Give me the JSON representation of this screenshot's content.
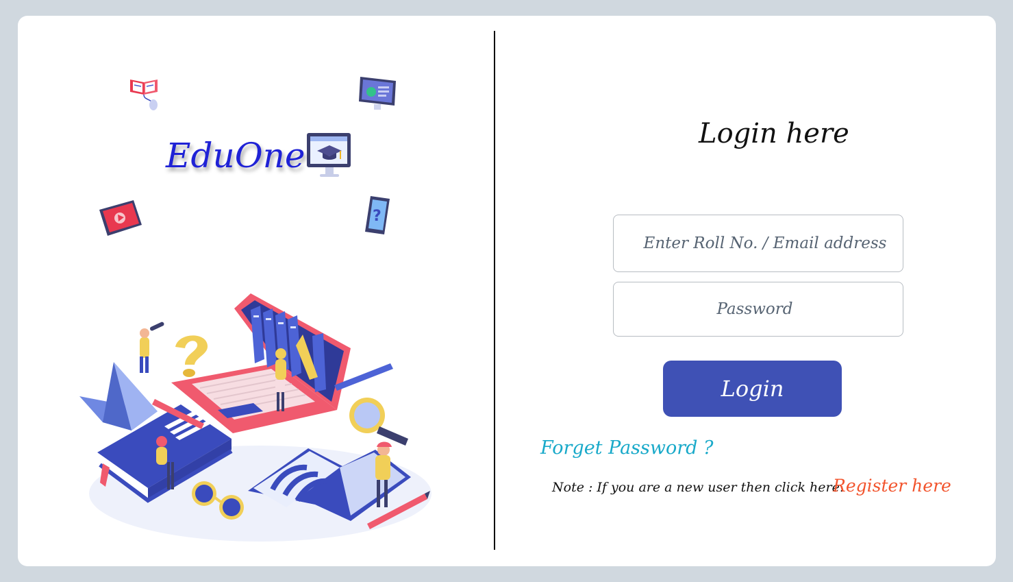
{
  "brand": {
    "name": "EduOne"
  },
  "login": {
    "title": "Login here",
    "roll_placeholder": "Enter Roll No. / Email address",
    "password_placeholder": "Password",
    "login_button": "Login",
    "forget_link": "Forget Password ?",
    "note": "Note : If you are a new user then click here.",
    "register_link": "Register here"
  },
  "colors": {
    "background": "#d0d8df",
    "card": "#ffffff",
    "brand": "#1f22d6",
    "button": "#3f51b5",
    "forget_link": "#18a9c9",
    "register_link": "#f2542d"
  },
  "icons": [
    "open-book-mouse-icon",
    "monitor-flask-icon",
    "monitor-graduation-cap-icon",
    "tablet-play-icon",
    "phone-question-icon",
    "education-illustration"
  ]
}
